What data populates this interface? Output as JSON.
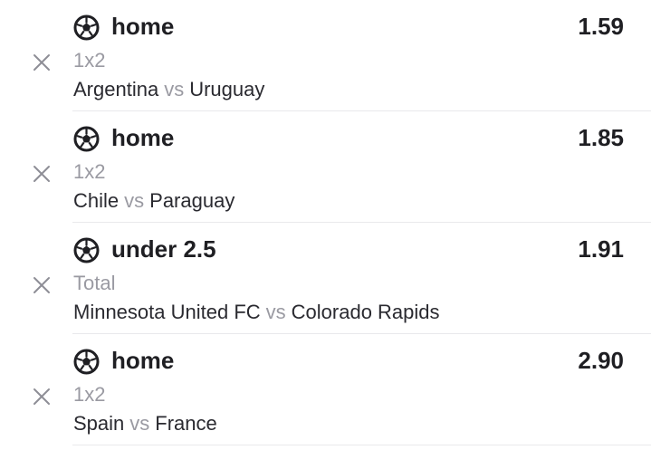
{
  "icons": {
    "sport": "soccer-ball-icon",
    "remove": "close-icon"
  },
  "colors": {
    "text_primary": "#1f1f23",
    "text_secondary": "#9a9aa2",
    "divider": "#e9e9ec"
  },
  "bets": [
    {
      "selection": "home",
      "market": "1x2",
      "team_home": "Argentina",
      "vs": "vs",
      "team_away": "Uruguay",
      "odds": "1.59"
    },
    {
      "selection": "home",
      "market": "1x2",
      "team_home": "Chile",
      "vs": "vs",
      "team_away": "Paraguay",
      "odds": "1.85"
    },
    {
      "selection": "under 2.5",
      "market": "Total",
      "team_home": "Minnesota United FC",
      "vs": "vs",
      "team_away": "Colorado Rapids",
      "odds": "1.91"
    },
    {
      "selection": "home",
      "market": "1x2",
      "team_home": "Spain",
      "vs": "vs",
      "team_away": "France",
      "odds": "2.90"
    }
  ]
}
